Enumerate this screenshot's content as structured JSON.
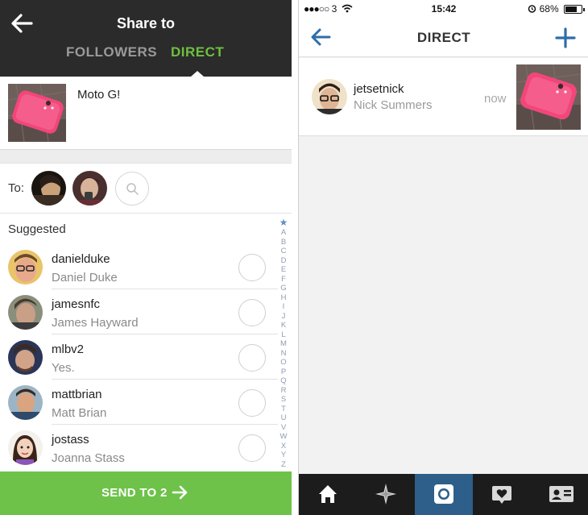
{
  "share": {
    "title": "Share to",
    "tabs": [
      {
        "label": "FOLLOWERS"
      },
      {
        "label": "DIRECT"
      }
    ],
    "caption": "Moto G!",
    "to_label": "To:",
    "suggested_heading": "Suggested",
    "suggested": [
      {
        "username": "danielduke",
        "name": "Daniel Duke"
      },
      {
        "username": "jamesnfc",
        "name": "James Hayward"
      },
      {
        "username": "mlbv2",
        "name": "Yes."
      },
      {
        "username": "mattbrian",
        "name": "Matt Brian"
      },
      {
        "username": "jostass",
        "name": "Joanna Stass"
      }
    ],
    "alphabet": [
      "★",
      "A",
      "B",
      "C",
      "D",
      "E",
      "F",
      "G",
      "H",
      "I",
      "J",
      "K",
      "L",
      "M",
      "N",
      "O",
      "P",
      "Q",
      "R",
      "S",
      "T",
      "U",
      "V",
      "W",
      "X",
      "Y",
      "Z"
    ],
    "send_label": "SEND TO 2"
  },
  "status_bar": {
    "signal": "●●●○○",
    "carrier": "3",
    "time": "15:42",
    "battery": "68%"
  },
  "direct": {
    "title": "DIRECT",
    "threads": [
      {
        "username": "jetsetnick",
        "name": "Nick Summers",
        "time": "now"
      }
    ]
  },
  "tabbar": {
    "items": [
      {
        "icon": "home-icon"
      },
      {
        "icon": "explore-icon"
      },
      {
        "icon": "camera-icon",
        "active": true
      },
      {
        "icon": "activity-icon"
      },
      {
        "icon": "profile-icon"
      }
    ]
  },
  "colors": {
    "header_dark": "#2b2b2b",
    "accent_green": "#6ec24a",
    "accent_blue": "#2d6ea8",
    "active_tab": "#2d5f8a"
  }
}
